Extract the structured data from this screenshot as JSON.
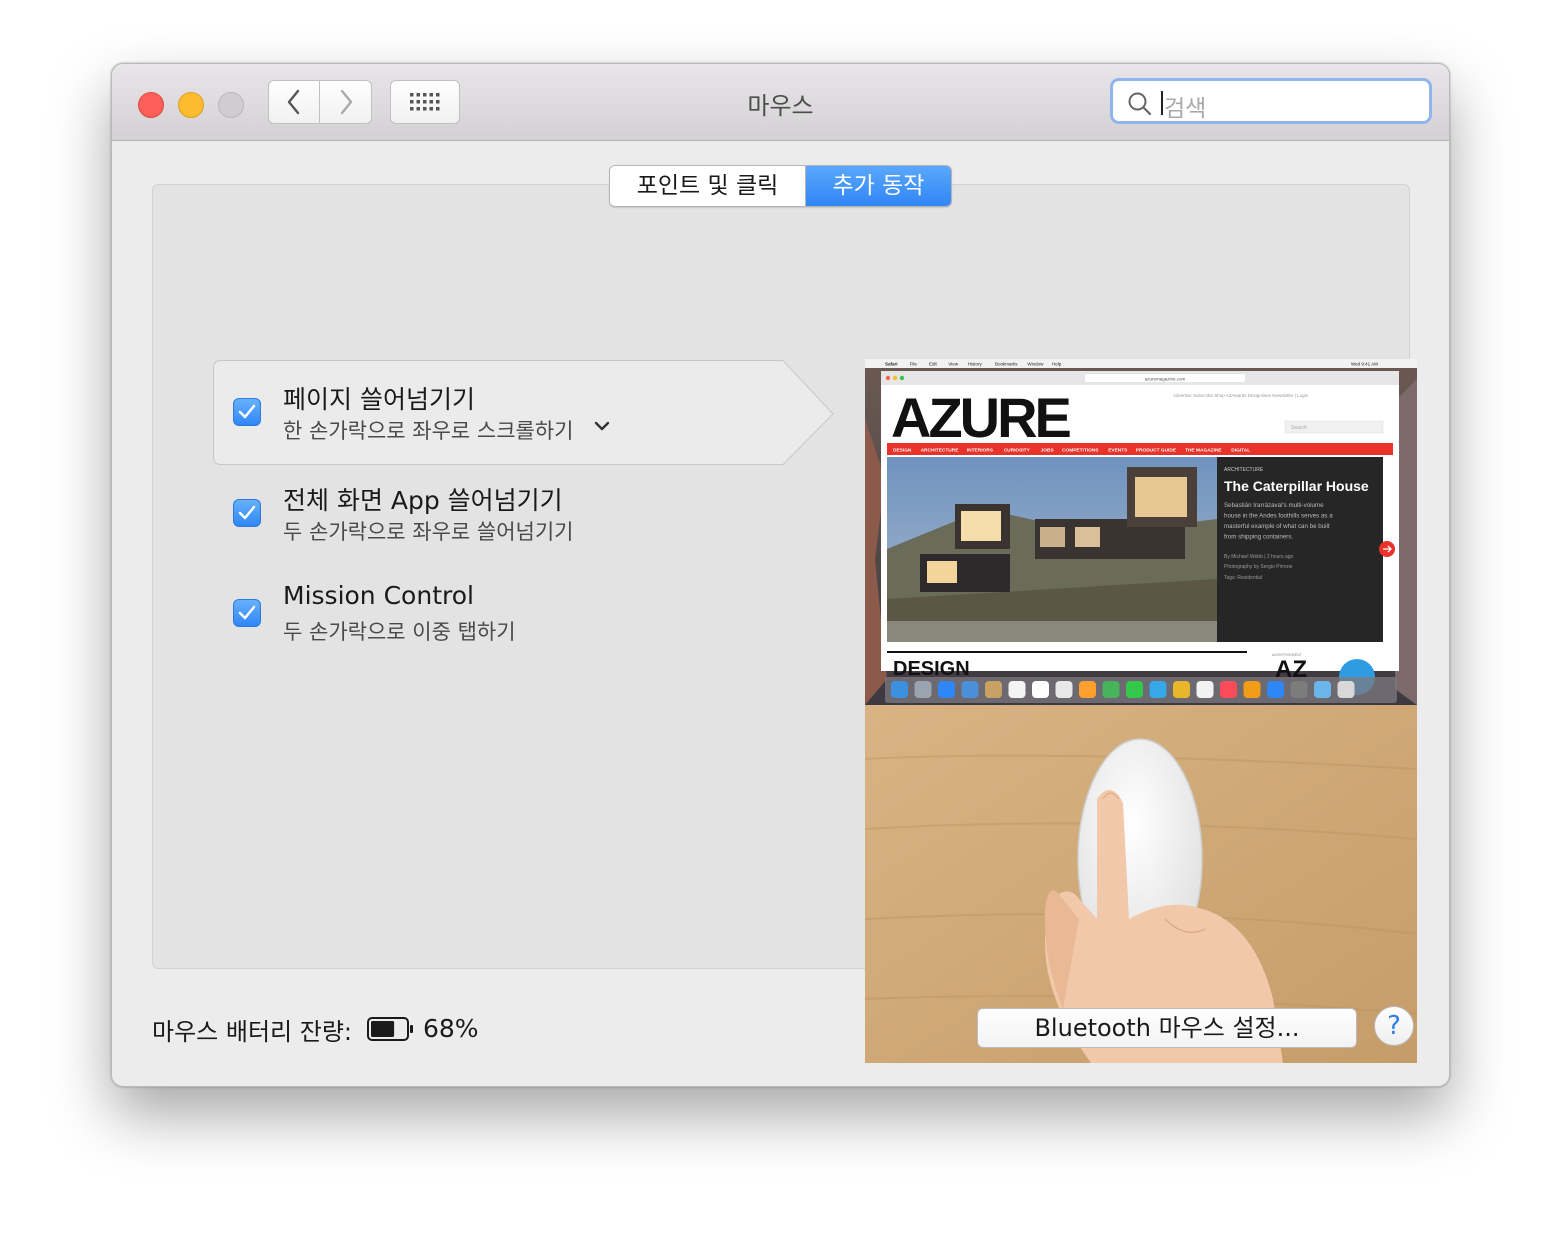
{
  "window": {
    "title": "마우스",
    "search_placeholder": "검색"
  },
  "tabs": [
    {
      "label": "포인트 및 클릭",
      "selected": false
    },
    {
      "label": "추가 동작",
      "selected": true
    }
  ],
  "gestures": [
    {
      "title": "페이지 쓸어넘기기",
      "subtitle": "한 손가락으로 좌우로 스크롤하기",
      "checked": true,
      "selected": true,
      "has_dropdown": true
    },
    {
      "title": "전체 화면 App 쓸어넘기기",
      "subtitle": "두 손가락으로 좌우로 쓸어넘기기",
      "checked": true,
      "selected": false
    },
    {
      "title": "Mission Control",
      "subtitle": "두 손가락으로 이중 탭하기",
      "checked": true,
      "selected": false
    }
  ],
  "preview": {
    "menubar": [
      "Safari",
      "File",
      "Edit",
      "View",
      "History",
      "Bookmarks",
      "Window",
      "Help"
    ],
    "clock": "Wed 9:41 AM",
    "url": "azuremagazine.com",
    "brand": "AZURE",
    "top_links": "Advertise  Subscribe  Shop  AZAwards  Designlines  Newsletter  | Login",
    "search_label": "Search",
    "nav": [
      "DESIGN",
      "ARCHITECTURE",
      "INTERIORS",
      "CURIOSITY",
      "JOBS",
      "COMPETITIONS",
      "EVENTS",
      "PRODUCT GUIDE",
      "THE MAGAZINE",
      "DIGITAL"
    ],
    "article_kicker": "ARCHITECTURE",
    "article_title": "The Caterpillar House",
    "article_body": [
      "Sebastián Irarrázaval's multi-volume",
      "house in the Andes foothills serves as a",
      "masterful example of what can be built",
      "from shipping containers."
    ],
    "byline": "By Michael Webb | 2 hours ago",
    "photo_credit": "Photography by Sergio Pirrone",
    "tags": "Tags: Residential",
    "section_heading": "DESIGN",
    "ad_label": "ADVERTISEMENT",
    "ad_text": "AZ"
  },
  "footer": {
    "battery_label": "마우스 배터리 잔량:",
    "battery_percent": "68%",
    "battery_level": 0.68,
    "bluetooth_button": "Bluetooth 마우스 설정...",
    "help_label": "?"
  },
  "colors": {
    "accent": "#2f86f6",
    "azure_red": "#e8322a",
    "close": "#fc5f57",
    "minimize": "#fdbc2e"
  }
}
